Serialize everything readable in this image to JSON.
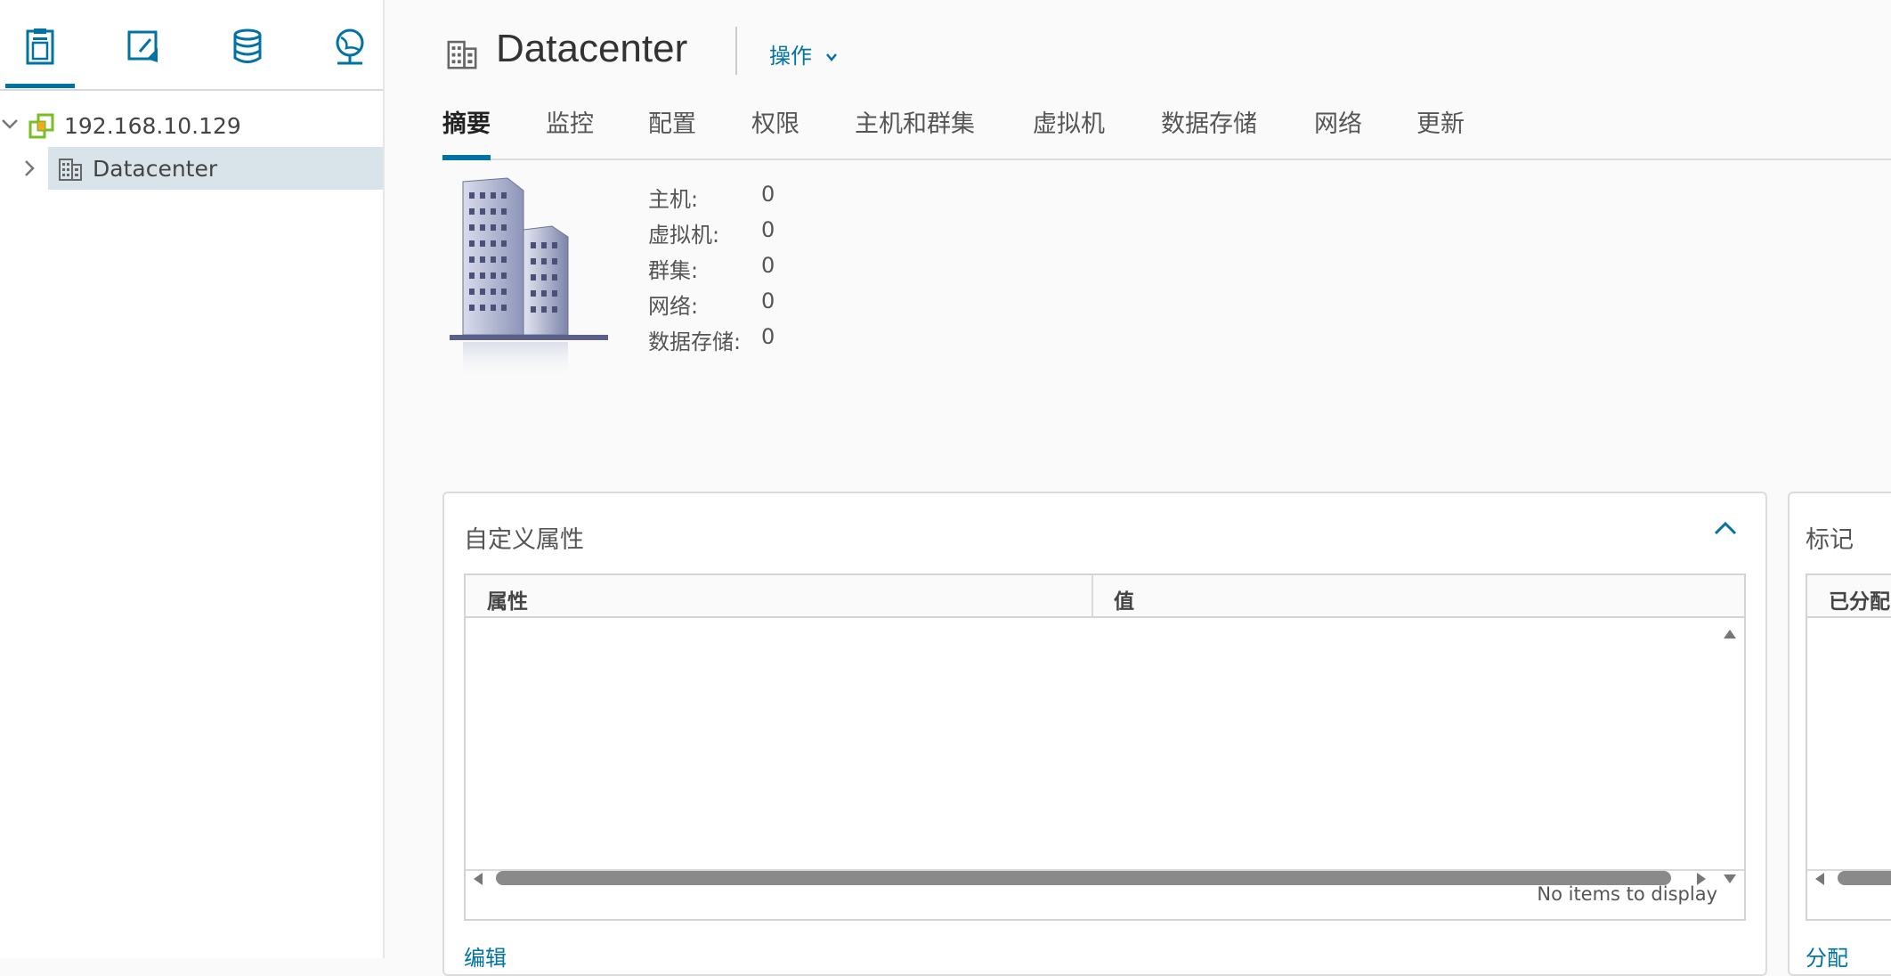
{
  "nav": {
    "tabs": [
      {
        "name": "hosts-clusters-icon",
        "active": true
      },
      {
        "name": "vms-templates-icon",
        "active": false
      },
      {
        "name": "storage-icon",
        "active": false
      },
      {
        "name": "networking-icon",
        "active": false
      }
    ],
    "tree": {
      "root": {
        "label": "192.168.10.129",
        "expanded": true
      },
      "child": {
        "label": "Datacenter",
        "selected": true
      }
    }
  },
  "header": {
    "title": "Datacenter",
    "actions_label": "操作"
  },
  "tabs": [
    "摘要",
    "监控",
    "配置",
    "权限",
    "主机和群集",
    "虚拟机",
    "数据存储",
    "网络",
    "更新"
  ],
  "summary": {
    "stats": [
      {
        "label": "主机:",
        "value": "0"
      },
      {
        "label": "虚拟机:",
        "value": "0"
      },
      {
        "label": "群集:",
        "value": "0"
      },
      {
        "label": "网络:",
        "value": "0"
      },
      {
        "label": "数据存储:",
        "value": "0"
      }
    ]
  },
  "custom_attributes": {
    "title": "自定义属性",
    "columns": [
      "属性",
      "值"
    ],
    "footer": "No items to display",
    "edit_link": "编辑"
  },
  "tags": {
    "title": "标记",
    "column": "已分配",
    "assign_link": "分配"
  },
  "colors": {
    "accent": "#0072a3",
    "selected_row": "#d9e4ea",
    "vsphere_green": "#78be20"
  }
}
